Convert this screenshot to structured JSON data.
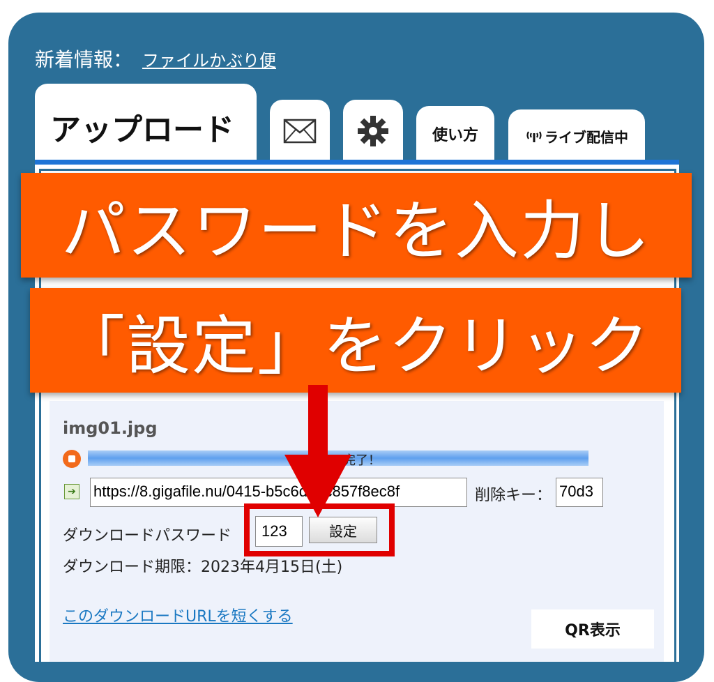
{
  "news": {
    "label": "新着情報：",
    "link": "ファイルかぶり便"
  },
  "tabs": {
    "upload": "アップロード",
    "mail_icon": "mail-icon",
    "settings_icon": "gear-icon",
    "howto": "使い方",
    "live": "ライブ配信中",
    "live_icon": "antenna-icon"
  },
  "overlay": {
    "line1": "パスワードを入力し",
    "line2": "「設定」をクリック",
    "arrow_color": "#e00000",
    "banner_color": "#ff5b00"
  },
  "upload_item": {
    "filename": "img01.jpg",
    "status_icon": "stop-icon",
    "progress_text": "完了！",
    "progress": 1.0,
    "link_icon": "arrow-right-icon",
    "url": "https://8.gigafile.nu/0415-b5c6d48c857f8ec8f",
    "delete_key_label": "削除キー：",
    "delete_key": "70d3",
    "password_label": "ダウンロードパスワード",
    "password_value": "123",
    "set_button": "設定",
    "deadline": "ダウンロード期限：2023年4月15日(土)",
    "shorten_link": "このダウンロードURLを短くする",
    "qr_button": "QR表示"
  },
  "colors": {
    "frame": "#2b6f98",
    "accent_line": "#1e74d6",
    "card": "#eef2fb",
    "link": "#1a78c2",
    "highlight": "#e00000"
  }
}
